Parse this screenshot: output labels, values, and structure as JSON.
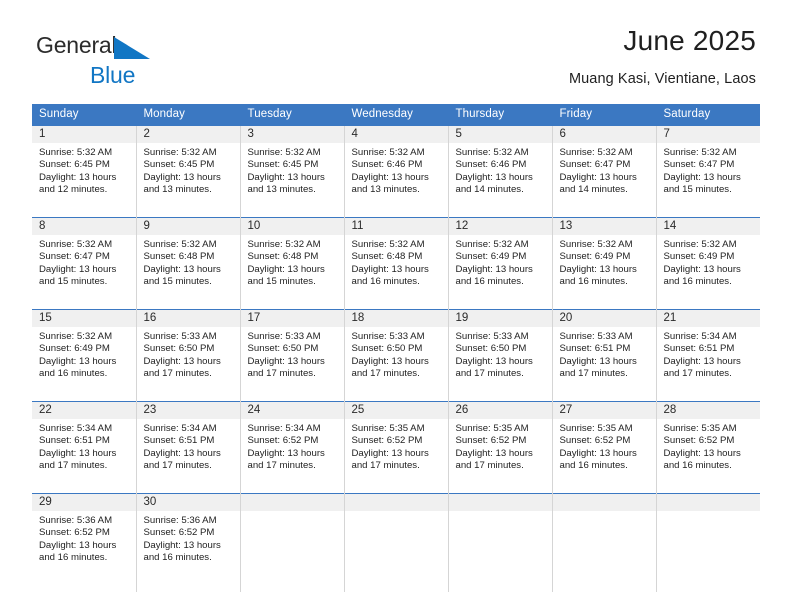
{
  "brand": {
    "name_part1": "General",
    "name_part2": "Blue",
    "triangle_color": "#1176c4"
  },
  "header": {
    "title": "June 2025",
    "subtitle": "Muang Kasi, Vientiane, Laos"
  },
  "colors": {
    "header_blue": "#3b78c2",
    "daynum_band": "#f0f0f0",
    "grid_line": "#d5d5d5",
    "text": "#1f1f1f"
  },
  "calendar": {
    "weekday_headers": [
      "Sunday",
      "Monday",
      "Tuesday",
      "Wednesday",
      "Thursday",
      "Friday",
      "Saturday"
    ],
    "weeks": [
      [
        {
          "day": "1",
          "sunrise": "Sunrise: 5:32 AM",
          "sunset": "Sunset: 6:45 PM",
          "daylight_line1": "Daylight: 13 hours",
          "daylight_line2": "and 12 minutes."
        },
        {
          "day": "2",
          "sunrise": "Sunrise: 5:32 AM",
          "sunset": "Sunset: 6:45 PM",
          "daylight_line1": "Daylight: 13 hours",
          "daylight_line2": "and 13 minutes."
        },
        {
          "day": "3",
          "sunrise": "Sunrise: 5:32 AM",
          "sunset": "Sunset: 6:45 PM",
          "daylight_line1": "Daylight: 13 hours",
          "daylight_line2": "and 13 minutes."
        },
        {
          "day": "4",
          "sunrise": "Sunrise: 5:32 AM",
          "sunset": "Sunset: 6:46 PM",
          "daylight_line1": "Daylight: 13 hours",
          "daylight_line2": "and 13 minutes."
        },
        {
          "day": "5",
          "sunrise": "Sunrise: 5:32 AM",
          "sunset": "Sunset: 6:46 PM",
          "daylight_line1": "Daylight: 13 hours",
          "daylight_line2": "and 14 minutes."
        },
        {
          "day": "6",
          "sunrise": "Sunrise: 5:32 AM",
          "sunset": "Sunset: 6:47 PM",
          "daylight_line1": "Daylight: 13 hours",
          "daylight_line2": "and 14 minutes."
        },
        {
          "day": "7",
          "sunrise": "Sunrise: 5:32 AM",
          "sunset": "Sunset: 6:47 PM",
          "daylight_line1": "Daylight: 13 hours",
          "daylight_line2": "and 15 minutes."
        }
      ],
      [
        {
          "day": "8",
          "sunrise": "Sunrise: 5:32 AM",
          "sunset": "Sunset: 6:47 PM",
          "daylight_line1": "Daylight: 13 hours",
          "daylight_line2": "and 15 minutes."
        },
        {
          "day": "9",
          "sunrise": "Sunrise: 5:32 AM",
          "sunset": "Sunset: 6:48 PM",
          "daylight_line1": "Daylight: 13 hours",
          "daylight_line2": "and 15 minutes."
        },
        {
          "day": "10",
          "sunrise": "Sunrise: 5:32 AM",
          "sunset": "Sunset: 6:48 PM",
          "daylight_line1": "Daylight: 13 hours",
          "daylight_line2": "and 15 minutes."
        },
        {
          "day": "11",
          "sunrise": "Sunrise: 5:32 AM",
          "sunset": "Sunset: 6:48 PM",
          "daylight_line1": "Daylight: 13 hours",
          "daylight_line2": "and 16 minutes."
        },
        {
          "day": "12",
          "sunrise": "Sunrise: 5:32 AM",
          "sunset": "Sunset: 6:49 PM",
          "daylight_line1": "Daylight: 13 hours",
          "daylight_line2": "and 16 minutes."
        },
        {
          "day": "13",
          "sunrise": "Sunrise: 5:32 AM",
          "sunset": "Sunset: 6:49 PM",
          "daylight_line1": "Daylight: 13 hours",
          "daylight_line2": "and 16 minutes."
        },
        {
          "day": "14",
          "sunrise": "Sunrise: 5:32 AM",
          "sunset": "Sunset: 6:49 PM",
          "daylight_line1": "Daylight: 13 hours",
          "daylight_line2": "and 16 minutes."
        }
      ],
      [
        {
          "day": "15",
          "sunrise": "Sunrise: 5:32 AM",
          "sunset": "Sunset: 6:49 PM",
          "daylight_line1": "Daylight: 13 hours",
          "daylight_line2": "and 16 minutes."
        },
        {
          "day": "16",
          "sunrise": "Sunrise: 5:33 AM",
          "sunset": "Sunset: 6:50 PM",
          "daylight_line1": "Daylight: 13 hours",
          "daylight_line2": "and 17 minutes."
        },
        {
          "day": "17",
          "sunrise": "Sunrise: 5:33 AM",
          "sunset": "Sunset: 6:50 PM",
          "daylight_line1": "Daylight: 13 hours",
          "daylight_line2": "and 17 minutes."
        },
        {
          "day": "18",
          "sunrise": "Sunrise: 5:33 AM",
          "sunset": "Sunset: 6:50 PM",
          "daylight_line1": "Daylight: 13 hours",
          "daylight_line2": "and 17 minutes."
        },
        {
          "day": "19",
          "sunrise": "Sunrise: 5:33 AM",
          "sunset": "Sunset: 6:50 PM",
          "daylight_line1": "Daylight: 13 hours",
          "daylight_line2": "and 17 minutes."
        },
        {
          "day": "20",
          "sunrise": "Sunrise: 5:33 AM",
          "sunset": "Sunset: 6:51 PM",
          "daylight_line1": "Daylight: 13 hours",
          "daylight_line2": "and 17 minutes."
        },
        {
          "day": "21",
          "sunrise": "Sunrise: 5:34 AM",
          "sunset": "Sunset: 6:51 PM",
          "daylight_line1": "Daylight: 13 hours",
          "daylight_line2": "and 17 minutes."
        }
      ],
      [
        {
          "day": "22",
          "sunrise": "Sunrise: 5:34 AM",
          "sunset": "Sunset: 6:51 PM",
          "daylight_line1": "Daylight: 13 hours",
          "daylight_line2": "and 17 minutes."
        },
        {
          "day": "23",
          "sunrise": "Sunrise: 5:34 AM",
          "sunset": "Sunset: 6:51 PM",
          "daylight_line1": "Daylight: 13 hours",
          "daylight_line2": "and 17 minutes."
        },
        {
          "day": "24",
          "sunrise": "Sunrise: 5:34 AM",
          "sunset": "Sunset: 6:52 PM",
          "daylight_line1": "Daylight: 13 hours",
          "daylight_line2": "and 17 minutes."
        },
        {
          "day": "25",
          "sunrise": "Sunrise: 5:35 AM",
          "sunset": "Sunset: 6:52 PM",
          "daylight_line1": "Daylight: 13 hours",
          "daylight_line2": "and 17 minutes."
        },
        {
          "day": "26",
          "sunrise": "Sunrise: 5:35 AM",
          "sunset": "Sunset: 6:52 PM",
          "daylight_line1": "Daylight: 13 hours",
          "daylight_line2": "and 17 minutes."
        },
        {
          "day": "27",
          "sunrise": "Sunrise: 5:35 AM",
          "sunset": "Sunset: 6:52 PM",
          "daylight_line1": "Daylight: 13 hours",
          "daylight_line2": "and 16 minutes."
        },
        {
          "day": "28",
          "sunrise": "Sunrise: 5:35 AM",
          "sunset": "Sunset: 6:52 PM",
          "daylight_line1": "Daylight: 13 hours",
          "daylight_line2": "and 16 minutes."
        }
      ],
      [
        {
          "day": "29",
          "sunrise": "Sunrise: 5:36 AM",
          "sunset": "Sunset: 6:52 PM",
          "daylight_line1": "Daylight: 13 hours",
          "daylight_line2": "and 16 minutes."
        },
        {
          "day": "30",
          "sunrise": "Sunrise: 5:36 AM",
          "sunset": "Sunset: 6:52 PM",
          "daylight_line1": "Daylight: 13 hours",
          "daylight_line2": "and 16 minutes."
        },
        {
          "day": "",
          "sunrise": "",
          "sunset": "",
          "daylight_line1": "",
          "daylight_line2": ""
        },
        {
          "day": "",
          "sunrise": "",
          "sunset": "",
          "daylight_line1": "",
          "daylight_line2": ""
        },
        {
          "day": "",
          "sunrise": "",
          "sunset": "",
          "daylight_line1": "",
          "daylight_line2": ""
        },
        {
          "day": "",
          "sunrise": "",
          "sunset": "",
          "daylight_line1": "",
          "daylight_line2": ""
        },
        {
          "day": "",
          "sunrise": "",
          "sunset": "",
          "daylight_line1": "",
          "daylight_line2": ""
        }
      ]
    ]
  }
}
